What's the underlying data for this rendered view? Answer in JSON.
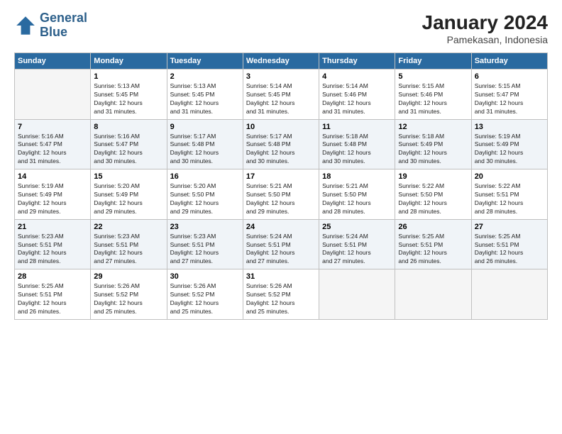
{
  "logo": {
    "line1": "General",
    "line2": "Blue"
  },
  "header": {
    "title": "January 2024",
    "subtitle": "Pamekasan, Indonesia"
  },
  "days_of_week": [
    "Sunday",
    "Monday",
    "Tuesday",
    "Wednesday",
    "Thursday",
    "Friday",
    "Saturday"
  ],
  "weeks": [
    [
      {
        "day": "",
        "sunrise": "",
        "sunset": "",
        "daylight": ""
      },
      {
        "day": "1",
        "sunrise": "Sunrise: 5:13 AM",
        "sunset": "Sunset: 5:45 PM",
        "daylight": "Daylight: 12 hours and 31 minutes."
      },
      {
        "day": "2",
        "sunrise": "Sunrise: 5:13 AM",
        "sunset": "Sunset: 5:45 PM",
        "daylight": "Daylight: 12 hours and 31 minutes."
      },
      {
        "day": "3",
        "sunrise": "Sunrise: 5:14 AM",
        "sunset": "Sunset: 5:45 PM",
        "daylight": "Daylight: 12 hours and 31 minutes."
      },
      {
        "day": "4",
        "sunrise": "Sunrise: 5:14 AM",
        "sunset": "Sunset: 5:46 PM",
        "daylight": "Daylight: 12 hours and 31 minutes."
      },
      {
        "day": "5",
        "sunrise": "Sunrise: 5:15 AM",
        "sunset": "Sunset: 5:46 PM",
        "daylight": "Daylight: 12 hours and 31 minutes."
      },
      {
        "day": "6",
        "sunrise": "Sunrise: 5:15 AM",
        "sunset": "Sunset: 5:47 PM",
        "daylight": "Daylight: 12 hours and 31 minutes."
      }
    ],
    [
      {
        "day": "7",
        "sunrise": "Sunrise: 5:16 AM",
        "sunset": "Sunset: 5:47 PM",
        "daylight": "Daylight: 12 hours and 31 minutes."
      },
      {
        "day": "8",
        "sunrise": "Sunrise: 5:16 AM",
        "sunset": "Sunset: 5:47 PM",
        "daylight": "Daylight: 12 hours and 30 minutes."
      },
      {
        "day": "9",
        "sunrise": "Sunrise: 5:17 AM",
        "sunset": "Sunset: 5:48 PM",
        "daylight": "Daylight: 12 hours and 30 minutes."
      },
      {
        "day": "10",
        "sunrise": "Sunrise: 5:17 AM",
        "sunset": "Sunset: 5:48 PM",
        "daylight": "Daylight: 12 hours and 30 minutes."
      },
      {
        "day": "11",
        "sunrise": "Sunrise: 5:18 AM",
        "sunset": "Sunset: 5:48 PM",
        "daylight": "Daylight: 12 hours and 30 minutes."
      },
      {
        "day": "12",
        "sunrise": "Sunrise: 5:18 AM",
        "sunset": "Sunset: 5:49 PM",
        "daylight": "Daylight: 12 hours and 30 minutes."
      },
      {
        "day": "13",
        "sunrise": "Sunrise: 5:19 AM",
        "sunset": "Sunset: 5:49 PM",
        "daylight": "Daylight: 12 hours and 30 minutes."
      }
    ],
    [
      {
        "day": "14",
        "sunrise": "Sunrise: 5:19 AM",
        "sunset": "Sunset: 5:49 PM",
        "daylight": "Daylight: 12 hours and 29 minutes."
      },
      {
        "day": "15",
        "sunrise": "Sunrise: 5:20 AM",
        "sunset": "Sunset: 5:49 PM",
        "daylight": "Daylight: 12 hours and 29 minutes."
      },
      {
        "day": "16",
        "sunrise": "Sunrise: 5:20 AM",
        "sunset": "Sunset: 5:50 PM",
        "daylight": "Daylight: 12 hours and 29 minutes."
      },
      {
        "day": "17",
        "sunrise": "Sunrise: 5:21 AM",
        "sunset": "Sunset: 5:50 PM",
        "daylight": "Daylight: 12 hours and 29 minutes."
      },
      {
        "day": "18",
        "sunrise": "Sunrise: 5:21 AM",
        "sunset": "Sunset: 5:50 PM",
        "daylight": "Daylight: 12 hours and 28 minutes."
      },
      {
        "day": "19",
        "sunrise": "Sunrise: 5:22 AM",
        "sunset": "Sunset: 5:50 PM",
        "daylight": "Daylight: 12 hours and 28 minutes."
      },
      {
        "day": "20",
        "sunrise": "Sunrise: 5:22 AM",
        "sunset": "Sunset: 5:51 PM",
        "daylight": "Daylight: 12 hours and 28 minutes."
      }
    ],
    [
      {
        "day": "21",
        "sunrise": "Sunrise: 5:23 AM",
        "sunset": "Sunset: 5:51 PM",
        "daylight": "Daylight: 12 hours and 28 minutes."
      },
      {
        "day": "22",
        "sunrise": "Sunrise: 5:23 AM",
        "sunset": "Sunset: 5:51 PM",
        "daylight": "Daylight: 12 hours and 27 minutes."
      },
      {
        "day": "23",
        "sunrise": "Sunrise: 5:23 AM",
        "sunset": "Sunset: 5:51 PM",
        "daylight": "Daylight: 12 hours and 27 minutes."
      },
      {
        "day": "24",
        "sunrise": "Sunrise: 5:24 AM",
        "sunset": "Sunset: 5:51 PM",
        "daylight": "Daylight: 12 hours and 27 minutes."
      },
      {
        "day": "25",
        "sunrise": "Sunrise: 5:24 AM",
        "sunset": "Sunset: 5:51 PM",
        "daylight": "Daylight: 12 hours and 27 minutes."
      },
      {
        "day": "26",
        "sunrise": "Sunrise: 5:25 AM",
        "sunset": "Sunset: 5:51 PM",
        "daylight": "Daylight: 12 hours and 26 minutes."
      },
      {
        "day": "27",
        "sunrise": "Sunrise: 5:25 AM",
        "sunset": "Sunset: 5:51 PM",
        "daylight": "Daylight: 12 hours and 26 minutes."
      }
    ],
    [
      {
        "day": "28",
        "sunrise": "Sunrise: 5:25 AM",
        "sunset": "Sunset: 5:51 PM",
        "daylight": "Daylight: 12 hours and 26 minutes."
      },
      {
        "day": "29",
        "sunrise": "Sunrise: 5:26 AM",
        "sunset": "Sunset: 5:52 PM",
        "daylight": "Daylight: 12 hours and 25 minutes."
      },
      {
        "day": "30",
        "sunrise": "Sunrise: 5:26 AM",
        "sunset": "Sunset: 5:52 PM",
        "daylight": "Daylight: 12 hours and 25 minutes."
      },
      {
        "day": "31",
        "sunrise": "Sunrise: 5:26 AM",
        "sunset": "Sunset: 5:52 PM",
        "daylight": "Daylight: 12 hours and 25 minutes."
      },
      {
        "day": "",
        "sunrise": "",
        "sunset": "",
        "daylight": ""
      },
      {
        "day": "",
        "sunrise": "",
        "sunset": "",
        "daylight": ""
      },
      {
        "day": "",
        "sunrise": "",
        "sunset": "",
        "daylight": ""
      }
    ]
  ]
}
